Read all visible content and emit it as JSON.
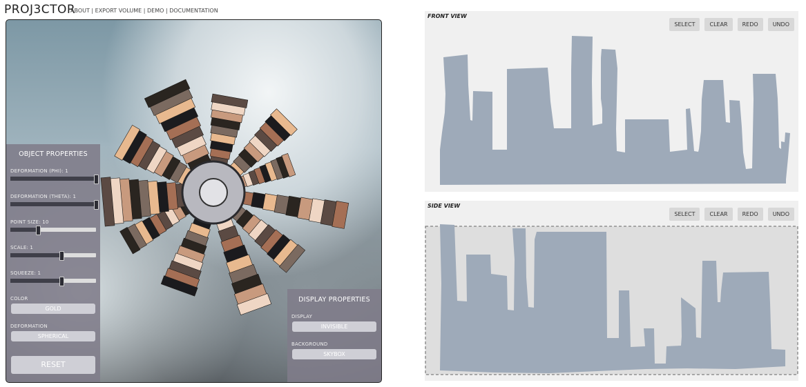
{
  "app": {
    "brand": "PROJ3CTOR",
    "nav": [
      "ABOUT",
      "EXPORT VOLUME",
      "DEMO",
      "DOCUMENTATION"
    ],
    "nav_sep": " | "
  },
  "object_properties": {
    "title": "OBJECT PROPERTIES",
    "sliders": [
      {
        "label": "DEFORMATION (PHI): 1",
        "value": 1.0
      },
      {
        "label": "DEFORMATION (THETA): 1",
        "value": 1.0
      },
      {
        "label": "POINT SIZE: 10",
        "value": 0.32
      },
      {
        "label": "SCALE: 1",
        "value": 0.6
      },
      {
        "label": "SQUEEZE: 1",
        "value": 0.6
      }
    ],
    "color_label": "COLOR",
    "color_value": "GOLD",
    "deformation_label": "DEFORMATION",
    "deformation_value": "SPHERICAL",
    "reset_label": "RESET"
  },
  "display_properties": {
    "title": "DISPLAY PROPERTIES",
    "display_label": "DISPLAY",
    "display_value": "INVISIBLE",
    "background_label": "BACKGROUND",
    "background_value": "SKYBOX"
  },
  "front_view": {
    "title": "FRONT VIEW",
    "buttons": [
      "SELECT",
      "CLEAR",
      "REDO",
      "UNDO"
    ]
  },
  "side_view": {
    "title": "SIDE VIEW",
    "buttons": [
      "SELECT",
      "CLEAR",
      "REDO",
      "UNDO"
    ]
  },
  "colors": {
    "silhouette": "#9eaab9",
    "panel": "#807c8a",
    "view_bg": "#f0f0f0"
  }
}
